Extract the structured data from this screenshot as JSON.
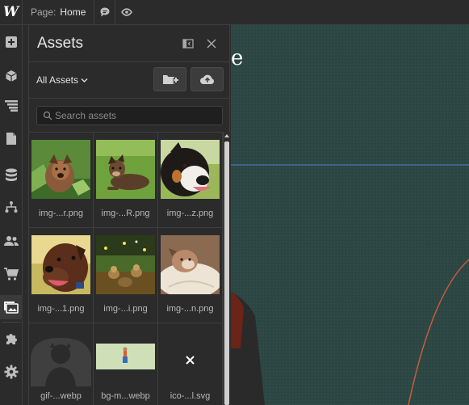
{
  "topbar": {
    "logo": "W",
    "page_label": "Page:",
    "page_value": "Home"
  },
  "panel": {
    "title": "Assets",
    "filter_label": "All Assets",
    "search_placeholder": "Search assets",
    "assets": [
      {
        "name": "img-...r.png"
      },
      {
        "name": "img-...R.png"
      },
      {
        "name": "img-...z.png"
      },
      {
        "name": "img-...1.png"
      },
      {
        "name": "img-...i.png"
      },
      {
        "name": "img-...n.png"
      },
      {
        "name": "gif-...webp"
      },
      {
        "name": "bg-m...webp"
      },
      {
        "name": "ico-...l.svg"
      }
    ]
  },
  "canvas": {
    "heading_fragment": "e"
  },
  "colors": {
    "canvas_bg": "#2d4744",
    "guide_line": "#4d7fd6",
    "curve_line": "#c85a3e",
    "panel_bg": "#2b2b2b"
  }
}
